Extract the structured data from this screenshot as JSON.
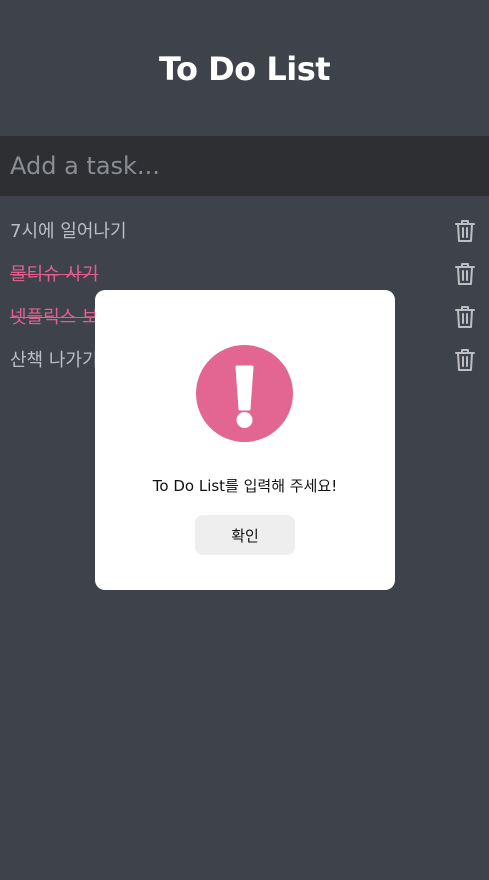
{
  "header": {
    "title": "To Do List"
  },
  "input": {
    "placeholder": "Add a task..."
  },
  "tasks": [
    {
      "label": "7시에 일어나기",
      "done": false
    },
    {
      "label": "물티슈 사기",
      "done": true
    },
    {
      "label": "넷플릭스 보기",
      "done": true
    },
    {
      "label": "산책 나가기",
      "done": false
    }
  ],
  "modal": {
    "message": "To Do List를 입력해 주세요!",
    "confirm_label": "확인",
    "icon": "exclamation-icon",
    "icon_color": "#e36592"
  },
  "colors": {
    "background": "#3e424a",
    "input_background": "#2d2f33",
    "accent_pink": "#e45f8e",
    "task_text": "#bcbec2"
  }
}
